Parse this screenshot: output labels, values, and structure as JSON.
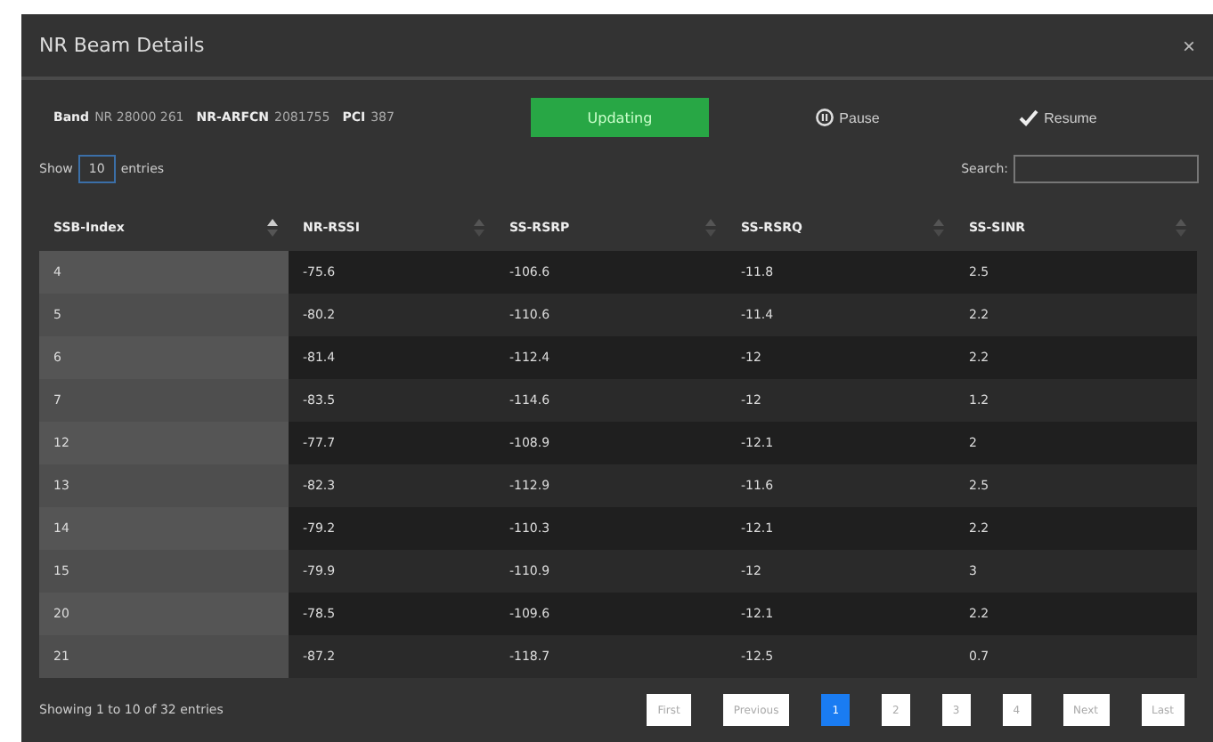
{
  "window": {
    "title": "NR Beam Details",
    "close": "×"
  },
  "info": [
    {
      "label": "Band",
      "value": "NR 28000 261"
    },
    {
      "label": "NR-ARFCN",
      "value": "2081755"
    },
    {
      "label": "PCI",
      "value": "387"
    }
  ],
  "status": {
    "label": "Updating",
    "on": true
  },
  "actions": [
    {
      "kind": "pause",
      "label": "Pause"
    },
    {
      "kind": "resume",
      "label": "Resume"
    }
  ],
  "length": {
    "before": "Show",
    "value": "10",
    "after": "entries"
  },
  "search": {
    "label": "Search:"
  },
  "table": {
    "columns": [
      {
        "label": "SSB-Index",
        "sorted": true
      },
      {
        "label": "NR-RSSI",
        "sorted": false
      },
      {
        "label": "SS-RSRP",
        "sorted": false
      },
      {
        "label": "SS-RSRQ",
        "sorted": false
      },
      {
        "label": "SS-SINR",
        "sorted": false
      }
    ],
    "rows": [
      [
        "4",
        "-75.6",
        "-106.6",
        "-11.8",
        "2.5"
      ],
      [
        "5",
        "-80.2",
        "-110.6",
        "-11.4",
        "2.2"
      ],
      [
        "6",
        "-81.4",
        "-112.4",
        "-12",
        "2.2"
      ],
      [
        "7",
        "-83.5",
        "-114.6",
        "-12",
        "1.2"
      ],
      [
        "12",
        "-77.7",
        "-108.9",
        "-12.1",
        "2"
      ],
      [
        "13",
        "-82.3",
        "-112.9",
        "-11.6",
        "2.5"
      ],
      [
        "14",
        "-79.2",
        "-110.3",
        "-12.1",
        "2.2"
      ],
      [
        "15",
        "-79.9",
        "-110.9",
        "-12",
        "3"
      ],
      [
        "20",
        "-78.5",
        "-109.6",
        "-12.1",
        "2.2"
      ],
      [
        "21",
        "-87.2",
        "-118.7",
        "-12.5",
        "0.7"
      ]
    ]
  },
  "footer": {
    "summary": "Showing 1 to 10 of 32 entries"
  },
  "pagination": [
    {
      "label": "First",
      "selected": false
    },
    {
      "label": "Previous",
      "selected": false
    },
    {
      "label": "1",
      "selected": true
    },
    {
      "label": "2",
      "selected": false
    },
    {
      "label": "3",
      "selected": false
    },
    {
      "label": "4",
      "selected": false
    },
    {
      "label": "Next",
      "selected": false
    },
    {
      "label": "Last",
      "selected": false
    }
  ]
}
